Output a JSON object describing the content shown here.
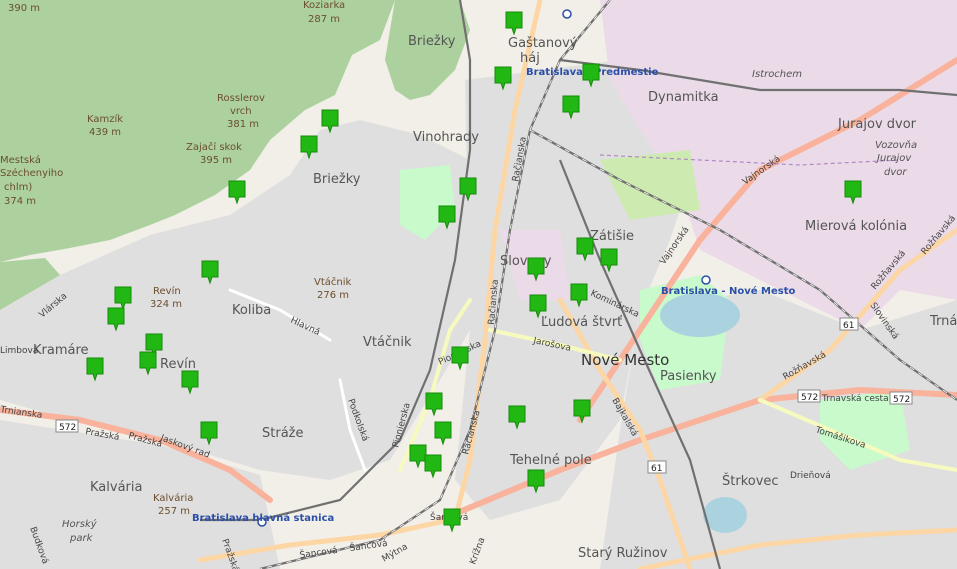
{
  "map": {
    "places": {
      "briezky_top": "Briežky",
      "gastanovy_1": "Gaštanový",
      "gastanovy_2": "háj",
      "istrochem": "Istrochem",
      "dynamitka": "Dynamitka",
      "jurajov_dvor": "Jurajov dvor",
      "vozovna_1": "Vozovňa",
      "vozovna_2": "Jurajov",
      "vozovna_3": "dvor",
      "vinohrady": "Vinohrady",
      "briezky_left": "Briežky",
      "zatisie": "Zátišie",
      "mierova": "Mierová kolónia",
      "slovany": "Slovany",
      "ludova": "Ľudová štvrť",
      "koliba": "Koliba",
      "vtacnik": "Vtáčnik",
      "kramare": "Kramáre",
      "revin": "Revín",
      "nove_mesto": "Nové Mesto",
      "pasienky": "Pasienky",
      "strmy": "Trná",
      "straze": "Stráže",
      "tehelne": "Tehelné pole",
      "kalvaria": "Kalvária",
      "strkovec": "Štrkovec",
      "stary_ruzinov": "Starý Ružinov",
      "horsky_1": "Horský",
      "horsky_2": "park"
    },
    "peaks": {
      "p390": "390 m",
      "koziarka": "Koziarka",
      "koziarka_h": "287 m",
      "kamzik": "Kamzík",
      "kamzik_h": "439 m",
      "rosslerov": "Rosslerov",
      "rosslerov_2": "vrch",
      "rosslerov_h": "381 m",
      "zajaci": "Zajačí skok",
      "zajaci_h": "395 m",
      "mestska_1": "Mestská",
      "mestska_2": "Széchenyiho",
      "mestska_3": "chlm)",
      "mestska_h": "374 m",
      "revin_p": "Revín",
      "revin_h": "324 m",
      "vtacnik_p": "Vtáčnik",
      "vtacnik_h": "276 m",
      "kalvaria_p": "Kalvária",
      "kalvaria_h": "257 m"
    },
    "stations": {
      "predmestie": "Bratislava - Predmestie",
      "nove_mesto": "Bratislava - Nové Mesto",
      "hlavna": "Bratislava hlavná stanica"
    },
    "streets": {
      "racianska1": "Račianska",
      "racianska2": "Račianska",
      "racianska3": "Račianska",
      "pionierska1": "Pionierska",
      "pionierska2": "Pionierska",
      "jarosova": "Jarošova",
      "bajkalska": "Bajkalská",
      "vajnorska1": "Vajnorská",
      "vajnorska2": "Vajnorská",
      "roznavska1": "Rožňavská",
      "roznavska2": "Rožňavská",
      "roznavska3": "Rožňavská",
      "trnavska": "Trnavská cesta",
      "tomasikova": "Tomášikova",
      "drienova": "Drieňová",
      "prazska1": "Pražská",
      "prazska2": "Pražská",
      "prazska3": "Pražská",
      "jaskovy": "Jaskový rad",
      "sancova1": "Šancová",
      "sancova2": "Šancová",
      "mytna": "Mýtna",
      "krizna": "Krížna",
      "hlavna_st": "Hlavná",
      "podkolska": "Podkolská",
      "vlarska": "Vlárska",
      "limbova": "Limbová",
      "trnianska": "Trnianska",
      "budkova": "Budková",
      "slovinska": "Slovinská",
      "zatisie_ul": "Kominárska",
      "jakubovova": "Jarošova",
      "sancova3": "Šancová"
    },
    "refs": {
      "r572a": "572",
      "r572b": "572",
      "r572c": "572",
      "r61a": "61",
      "r61b": "61"
    },
    "colors": {
      "forest": "#add19e",
      "residential": "#e0dfdf",
      "industrial": "#ebdbe8",
      "park": "#c8facc",
      "water": "#aad3df",
      "primary": "#fcd6a4",
      "trunk": "#f9b29c",
      "secondary": "#f7fabf",
      "rail": "#707070",
      "marker": "#22b814"
    },
    "markers": [
      {
        "id": 1,
        "icon": "map-pin-icon"
      },
      {
        "id": 2,
        "icon": "map-pin-icon"
      },
      {
        "id": 3,
        "icon": "map-pin-icon"
      },
      {
        "id": 4,
        "icon": "map-pin-icon"
      },
      {
        "id": 5,
        "icon": "map-pin-icon"
      },
      {
        "id": 6,
        "icon": "map-pin-icon"
      },
      {
        "id": 7,
        "icon": "map-pin-icon"
      },
      {
        "id": 8,
        "icon": "map-pin-icon"
      },
      {
        "id": 9,
        "icon": "map-pin-icon"
      },
      {
        "id": 10,
        "icon": "map-pin-icon"
      },
      {
        "id": 11,
        "icon": "map-pin-icon"
      },
      {
        "id": 12,
        "icon": "map-pin-icon"
      },
      {
        "id": 13,
        "icon": "map-pin-icon"
      },
      {
        "id": 14,
        "icon": "map-pin-icon"
      },
      {
        "id": 15,
        "icon": "map-pin-icon"
      },
      {
        "id": 16,
        "icon": "map-pin-icon"
      },
      {
        "id": 17,
        "icon": "map-pin-icon"
      },
      {
        "id": 18,
        "icon": "map-pin-icon"
      },
      {
        "id": 19,
        "icon": "map-pin-icon"
      },
      {
        "id": 20,
        "icon": "map-pin-icon"
      },
      {
        "id": 21,
        "icon": "map-pin-icon"
      },
      {
        "id": 22,
        "icon": "map-pin-icon"
      },
      {
        "id": 23,
        "icon": "map-pin-icon"
      },
      {
        "id": 24,
        "icon": "map-pin-icon"
      },
      {
        "id": 25,
        "icon": "map-pin-icon"
      },
      {
        "id": 26,
        "icon": "map-pin-icon"
      },
      {
        "id": 27,
        "icon": "map-pin-icon"
      },
      {
        "id": 28,
        "icon": "map-pin-icon"
      },
      {
        "id": 29,
        "icon": "map-pin-icon"
      },
      {
        "id": 30,
        "icon": "map-pin-icon"
      },
      {
        "id": 31,
        "icon": "map-pin-icon"
      },
      {
        "id": 32,
        "icon": "map-pin-icon"
      },
      {
        "id": 33,
        "icon": "map-pin-icon"
      },
      {
        "id": 34,
        "icon": "map-pin-icon"
      }
    ]
  }
}
